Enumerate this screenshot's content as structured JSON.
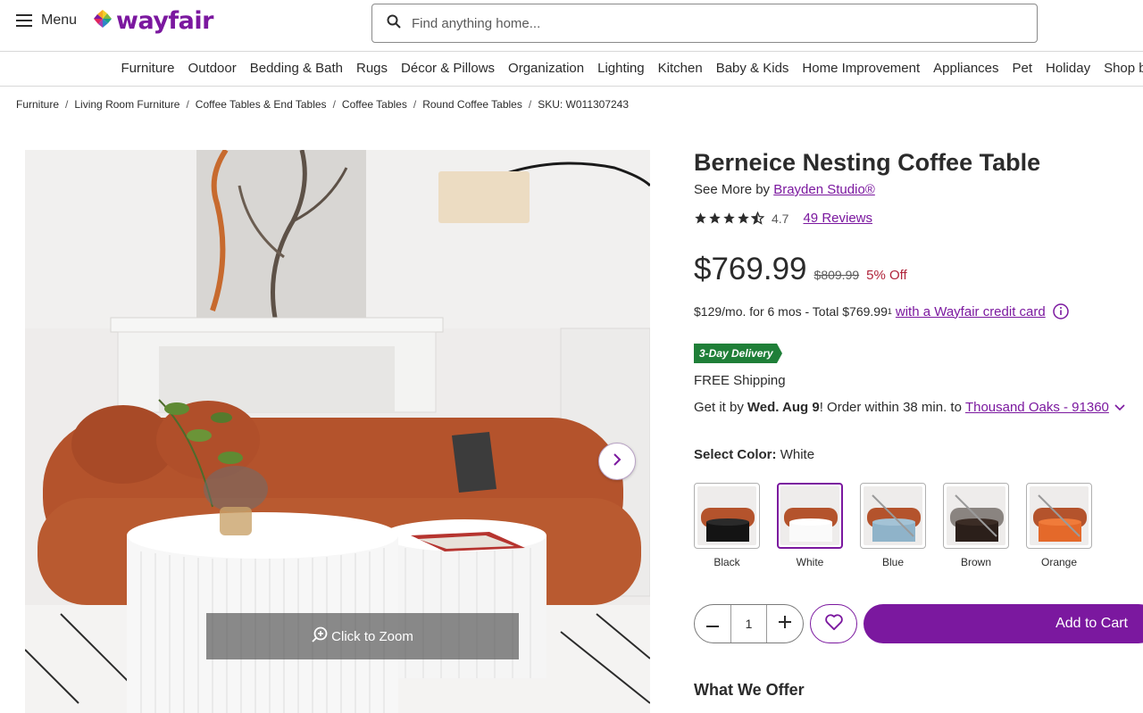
{
  "header": {
    "menu_label": "Menu",
    "logo_text": "wayfair",
    "search_placeholder": "Find anything home..."
  },
  "categories": [
    "Furniture",
    "Outdoor",
    "Bedding & Bath",
    "Rugs",
    "Décor & Pillows",
    "Organization",
    "Lighting",
    "Kitchen",
    "Baby & Kids",
    "Home Improvement",
    "Appliances",
    "Pet",
    "Holiday",
    "Shop by Room"
  ],
  "breadcrumb": [
    "Furniture",
    "Living Room Furniture",
    "Coffee Tables & End Tables",
    "Coffee Tables",
    "Round Coffee Tables"
  ],
  "breadcrumb_sku": "SKU: W011307243",
  "gallery": {
    "zoom_label": "Click to Zoom"
  },
  "product": {
    "title": "Berneice Nesting Coffee Table",
    "brand_prefix": "See More by",
    "brand": "Brayden Studio®",
    "rating_value": "4.7",
    "rating_stars": 4.5,
    "reviews_link": "49 Reviews",
    "price": "$769.99",
    "old_price": "$809.99",
    "discount": "5% Off",
    "finance_text": "$129/mo. for 6 mos - Total $769.99",
    "finance_sup": "1",
    "finance_link": "with a Wayfair credit card",
    "delivery_badge": "3-Day Delivery",
    "shipping": "FREE Shipping",
    "delivery_prefix": "Get it by",
    "delivery_date": "Wed. Aug 9",
    "delivery_suffix": "! Order within 38 min. to",
    "delivery_location": "Thousand Oaks - 91360",
    "select_color_label": "Select Color:",
    "selected_color": "White",
    "colors": [
      "Black",
      "White",
      "Blue",
      "Brown",
      "Orange"
    ],
    "quantity": "1",
    "add_to_cart": "Add to Cart",
    "what_we_offer": "What We Offer"
  },
  "colors_hex": {
    "brand": "#7b189f",
    "discount": "#b0243b",
    "badge": "#1f7f38"
  }
}
